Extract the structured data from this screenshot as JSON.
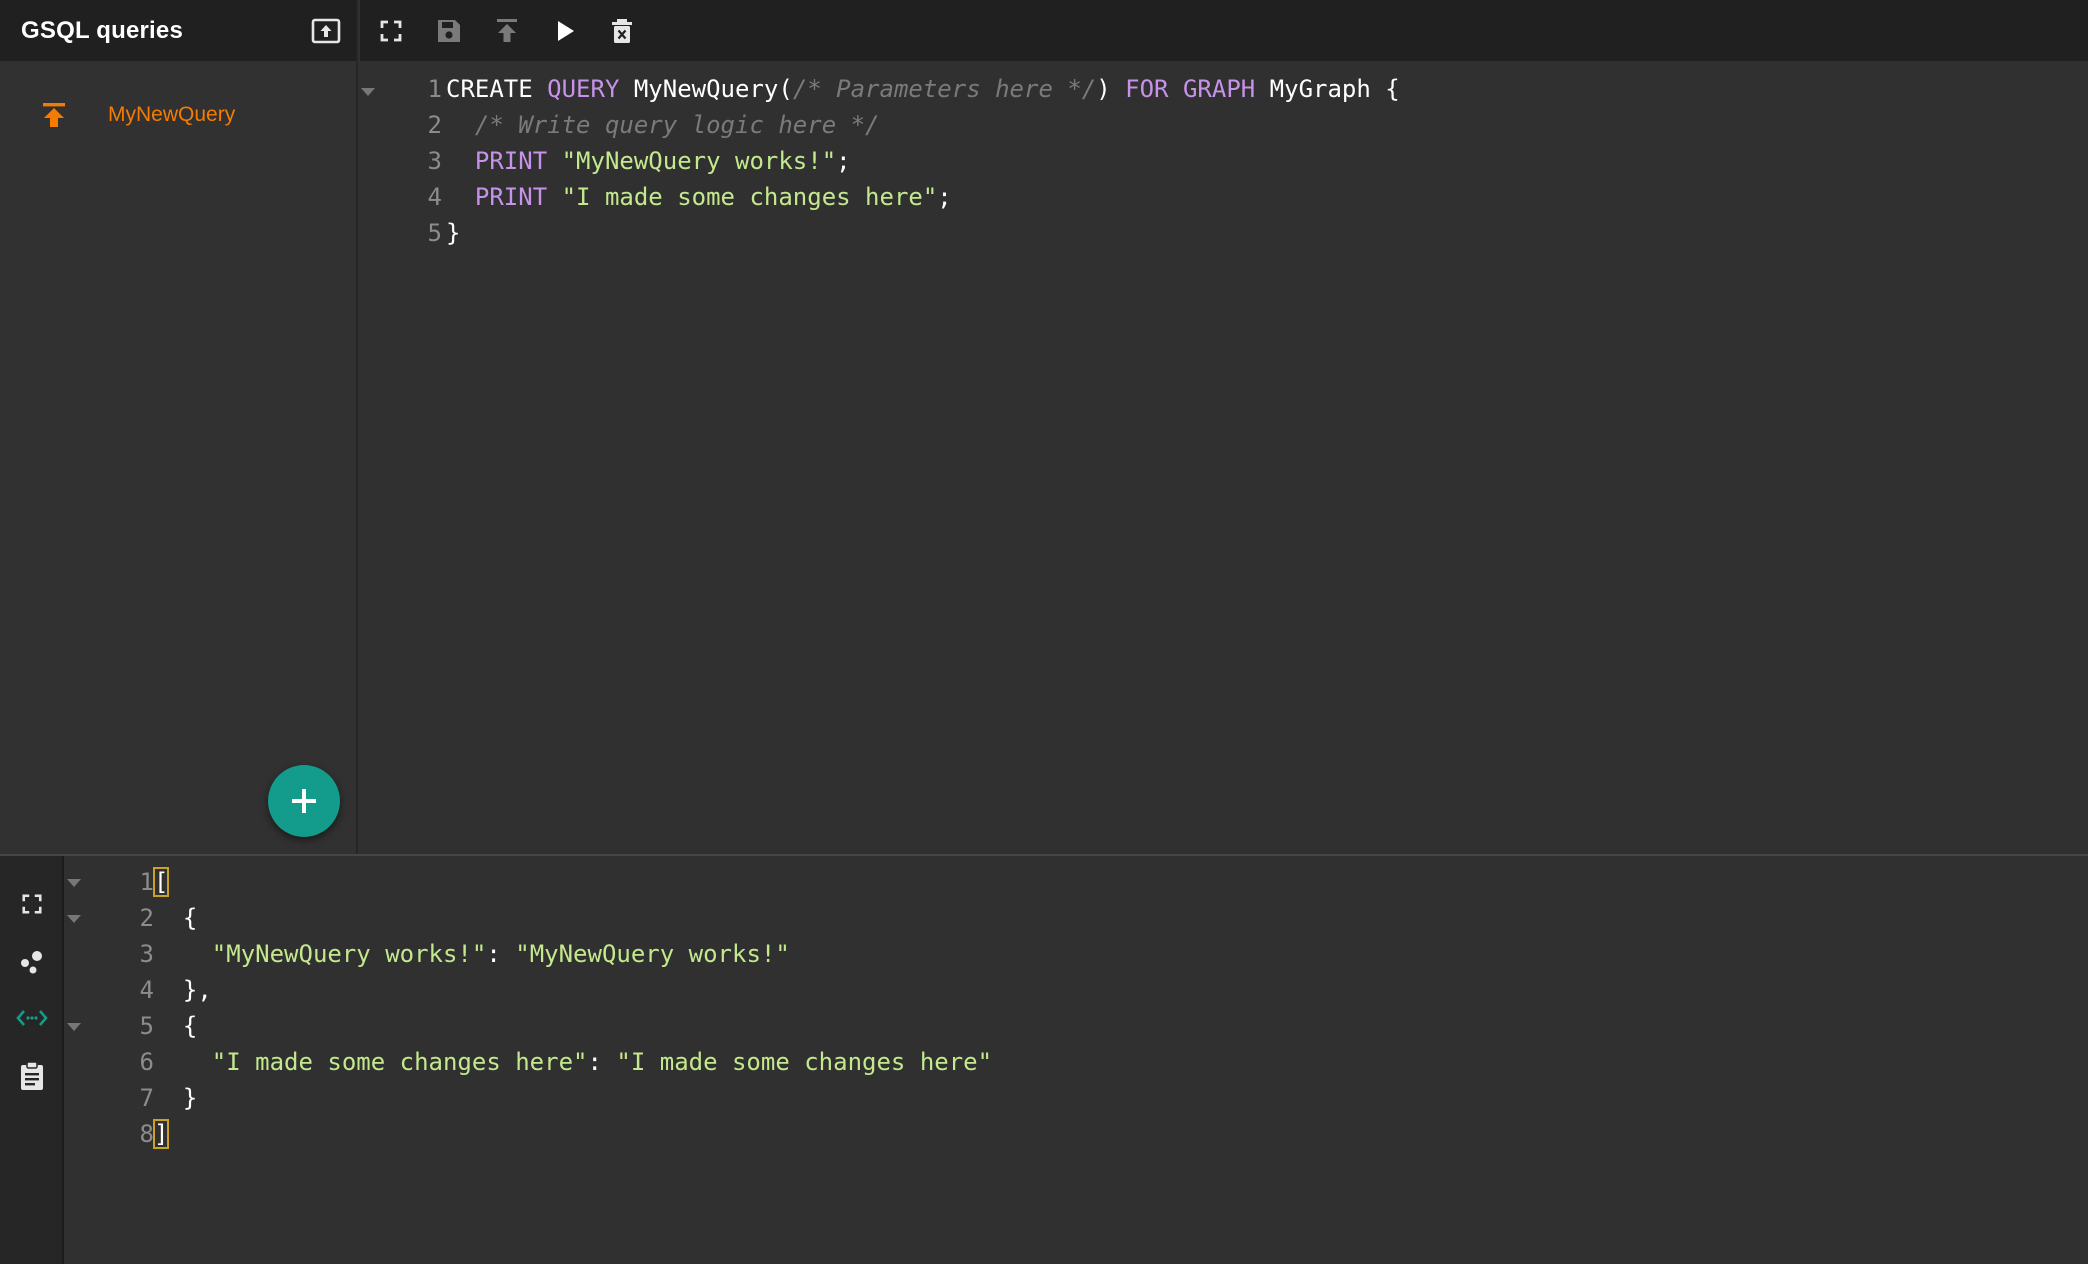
{
  "sidebar": {
    "title": "GSQL queries",
    "upload_icon": "upload-box-icon",
    "queries": [
      {
        "name": "MyNewQuery",
        "status_icon": "publish-arrow-icon",
        "color": "#f57c00"
      }
    ],
    "add_icon": "plus-icon"
  },
  "toolbar": {
    "buttons": [
      "fullscreen-icon",
      "save-icon",
      "install-icon",
      "run-icon",
      "delete-icon"
    ]
  },
  "editor": {
    "lines": [
      {
        "num": "1",
        "tokens": [
          {
            "t": "CREATE",
            "c": "tok-name"
          },
          {
            "t": " ",
            "c": "tok-punc"
          },
          {
            "t": "QUERY",
            "c": "tok-kw"
          },
          {
            "t": " ",
            "c": "tok-punc"
          },
          {
            "t": "MyNewQuery(",
            "c": "tok-name"
          },
          {
            "t": "/* Parameters here */",
            "c": "tok-comment"
          },
          {
            "t": ") ",
            "c": "tok-punc"
          },
          {
            "t": "FOR",
            "c": "tok-kw"
          },
          {
            "t": " ",
            "c": "tok-punc"
          },
          {
            "t": "GRAPH",
            "c": "tok-kw"
          },
          {
            "t": " ",
            "c": "tok-punc"
          },
          {
            "t": "MyGraph {",
            "c": "tok-name"
          }
        ]
      },
      {
        "num": "2",
        "tokens": [
          {
            "t": "  ",
            "c": "tok-punc"
          },
          {
            "t": "/* Write query logic here */",
            "c": "tok-comment"
          }
        ]
      },
      {
        "num": "3",
        "tokens": [
          {
            "t": "  ",
            "c": "tok-punc"
          },
          {
            "t": "PRINT",
            "c": "tok-kw"
          },
          {
            "t": " ",
            "c": "tok-punc"
          },
          {
            "t": "\"MyNewQuery works!\"",
            "c": "tok-str"
          },
          {
            "t": ";",
            "c": "tok-punc"
          }
        ]
      },
      {
        "num": "4",
        "tokens": [
          {
            "t": "  ",
            "c": "tok-punc"
          },
          {
            "t": "PRINT",
            "c": "tok-kw"
          },
          {
            "t": " ",
            "c": "tok-punc"
          },
          {
            "t": "\"I made some changes here\"",
            "c": "tok-str"
          },
          {
            "t": ";",
            "c": "tok-punc"
          }
        ]
      },
      {
        "num": "5",
        "tokens": [
          {
            "t": "}",
            "c": "tok-punc"
          }
        ]
      }
    ]
  },
  "output": {
    "rail_icons": [
      "fullscreen-icon",
      "graph-visual-icon",
      "json-view-icon",
      "clipboard-log-icon"
    ],
    "lines": [
      {
        "num": "1",
        "tokens": [
          {
            "t": "[",
            "c": "tok-punc",
            "m": true
          }
        ]
      },
      {
        "num": "2",
        "tokens": [
          {
            "t": "  {",
            "c": "tok-punc"
          }
        ]
      },
      {
        "num": "3",
        "tokens": [
          {
            "t": "    ",
            "c": "tok-punc"
          },
          {
            "t": "\"MyNewQuery works!\"",
            "c": "tok-str"
          },
          {
            "t": ": ",
            "c": "tok-punc"
          },
          {
            "t": "\"MyNewQuery works!\"",
            "c": "tok-str"
          }
        ]
      },
      {
        "num": "4",
        "tokens": [
          {
            "t": "  },",
            "c": "tok-punc"
          }
        ]
      },
      {
        "num": "5",
        "tokens": [
          {
            "t": "  {",
            "c": "tok-punc"
          }
        ]
      },
      {
        "num": "6",
        "tokens": [
          {
            "t": "    ",
            "c": "tok-punc"
          },
          {
            "t": "\"I made some changes here\"",
            "c": "tok-str"
          },
          {
            "t": ": ",
            "c": "tok-punc"
          },
          {
            "t": "\"I made some changes here\"",
            "c": "tok-str"
          }
        ]
      },
      {
        "num": "7",
        "tokens": [
          {
            "t": "  }",
            "c": "tok-punc"
          }
        ]
      },
      {
        "num": "8",
        "tokens": [
          {
            "t": "]",
            "c": "tok-punc",
            "m": true
          }
        ]
      }
    ]
  },
  "colors": {
    "accent": "#139b8c",
    "query_active": "#f57c00",
    "keyword": "#c792ea",
    "string": "#c3e88d"
  }
}
